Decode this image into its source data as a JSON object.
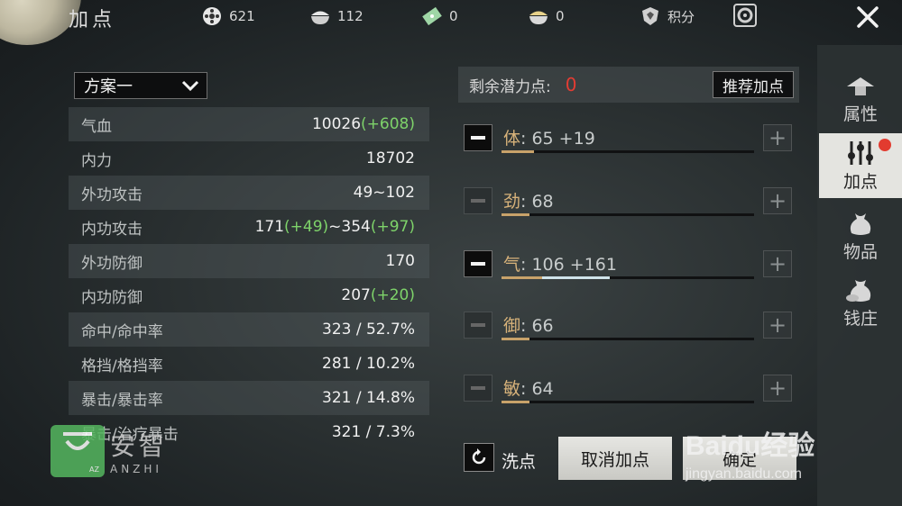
{
  "header": {
    "title": "加点",
    "currencies": [
      {
        "icon": "film-reel-icon",
        "value": "621"
      },
      {
        "icon": "bowl-icon",
        "value": "112"
      },
      {
        "icon": "jade-ticket-icon",
        "value": "0"
      },
      {
        "icon": "gold-bowl-icon",
        "value": "0"
      }
    ],
    "points_label": "积分"
  },
  "plan": {
    "selected": "方案一"
  },
  "stats": [
    {
      "label": "气血",
      "value": "10026",
      "bonus": "(+608)",
      "tail": "",
      "bonus2": ""
    },
    {
      "label": "内力",
      "value": "18702",
      "bonus": "",
      "tail": "",
      "bonus2": ""
    },
    {
      "label": "外功攻击",
      "value": "49~102",
      "bonus": "",
      "tail": "",
      "bonus2": ""
    },
    {
      "label": "内功攻击",
      "value": "171",
      "bonus": "(+49)",
      "tail": "~354",
      "bonus2": "(+97)"
    },
    {
      "label": "外功防御",
      "value": "170",
      "bonus": "",
      "tail": "",
      "bonus2": ""
    },
    {
      "label": "内功防御",
      "value": "207",
      "bonus": "(+20)",
      "tail": "",
      "bonus2": ""
    },
    {
      "label": "命中/命中率",
      "value": "323 / 52.7%",
      "bonus": "",
      "tail": "",
      "bonus2": ""
    },
    {
      "label": "格挡/格挡率",
      "value": "281 / 10.2%",
      "bonus": "",
      "tail": "",
      "bonus2": ""
    },
    {
      "label": "暴击/暴击率",
      "value": "321 / 14.8%",
      "bonus": "",
      "tail": "",
      "bonus2": ""
    },
    {
      "label": "暴击/治疗暴击",
      "value": "321 / 7.3%",
      "bonus": "",
      "tail": "",
      "bonus2": ""
    }
  ],
  "points": {
    "remaining_label": "剩余潜力点:",
    "remaining_value": "0",
    "recommend_label": "推荐加点"
  },
  "attributes": [
    {
      "name": "体",
      "value": "65 +19",
      "base_fraction": 0.13,
      "added_fraction": 0.0,
      "minus_enabled": true
    },
    {
      "name": "劲",
      "value": "68",
      "base_fraction": 0.11,
      "added_fraction": 0.0,
      "minus_enabled": false
    },
    {
      "name": "气",
      "value": "106 +161",
      "base_fraction": 0.16,
      "added_fraction": 0.27,
      "minus_enabled": true
    },
    {
      "name": "御",
      "value": "66",
      "base_fraction": 0.11,
      "added_fraction": 0.0,
      "minus_enabled": false
    },
    {
      "name": "敏",
      "value": "64",
      "base_fraction": 0.11,
      "added_fraction": 0.0,
      "minus_enabled": false
    }
  ],
  "actions": {
    "reset_label": "洗点",
    "cancel_label": "取消加点",
    "confirm_label": "确定"
  },
  "sidebar": [
    {
      "label": "属性",
      "icon": "hat-icon",
      "active": false,
      "badge": false
    },
    {
      "label": "加点",
      "icon": "sliders-icon",
      "active": true,
      "badge": true
    },
    {
      "label": "物品",
      "icon": "bag-icon",
      "active": false,
      "badge": false
    },
    {
      "label": "钱庄",
      "icon": "money-bag-icon",
      "active": false,
      "badge": false
    }
  ],
  "watermarks": {
    "anzhi_cn": "安智",
    "anzhi_en": "ANZHI",
    "anzhi_logo": "AZ",
    "baidu_logo": "Baidu经验",
    "baidu_url": "jingyan.baidu.com"
  },
  "colors": {
    "bonus_green": "#7ed36a",
    "remaining_red": "#e33c33",
    "attr_gold": "#d7b27a"
  }
}
